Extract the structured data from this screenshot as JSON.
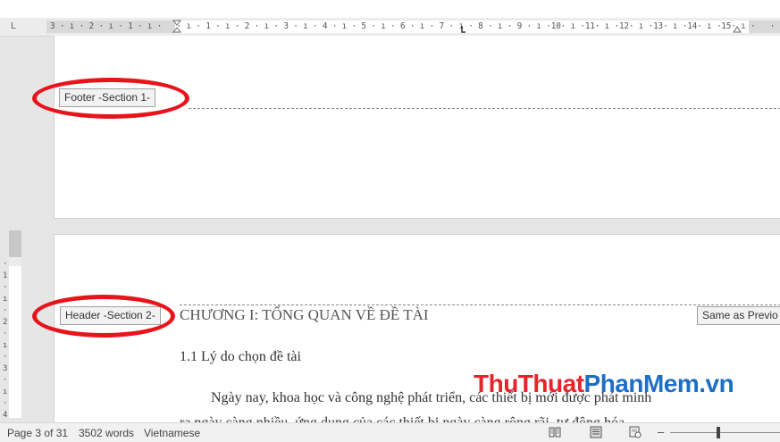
{
  "ruler": {
    "tab_selector": "L",
    "horizontal_ticks": "3 · ı · 2 · ı · 1 · ı ·   · ı · 1 · ı · 2 · ı · 3 · ı · 4 · ı · 5 · ı · 6 · ı · 7 · ı · 8 · ı · 9 · ı ·10· ı ·11· ı ·12· ı ·13· ı ·14· ı ·15· ı ·   · ı ·17",
    "vertical_ticks": "· 1 · ı · 2 · ı · 3 · ı · 4"
  },
  "page1": {
    "footer_tag": "Footer -Section 1-"
  },
  "page2": {
    "header_tag": "Header -Section 2-",
    "same_as_previous": "Same as Previo",
    "chapter_title": "CHƯƠNG I: TỔNG QUAN VỀ ĐỀ TÀI",
    "subheading": "1.1 Lý do chọn đề tài",
    "body_line1": "Ngày nay, khoa học và công nghệ phát triển, các thiết bị mới được phát minh",
    "body_line2": "ra ngày càng nhiều, ứng dụng của các thiết bị ngày càng rộng rãi, tự động hóa"
  },
  "watermark": {
    "part1": "ThuThuat",
    "part2": "PhanMem",
    "part3": ".vn"
  },
  "status_bar": {
    "page": "Page 3 of 31",
    "words": "3502 words",
    "language": "Vietnamese",
    "zoom_minus": "–"
  },
  "icons": {
    "read_mode": "book-icon",
    "print_layout": "page-icon",
    "web_layout": "web-icon"
  },
  "colors": {
    "highlight_ellipse": "#e8141b",
    "watermark_red": "#e8232b",
    "watermark_blue": "#1e6fc4"
  }
}
